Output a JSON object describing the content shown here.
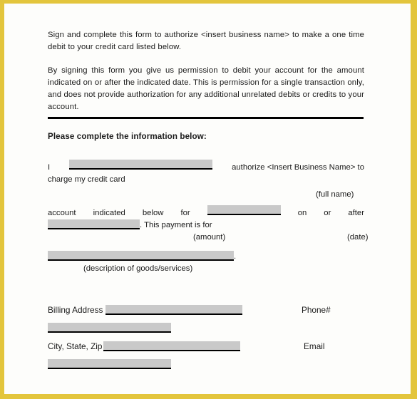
{
  "document": {
    "paragraphs": [
      "Sign and complete this form to authorize <insert business name> to make a one time debit to your credit card listed below.",
      "By signing this form you give us permission to debit your account for the amount indicated on or after the indicated date.  This is permission for a single transaction only, and does not provide authorization for any additional unrelated debits or credits to your account."
    ],
    "section_heading": "Please complete the information below:",
    "authorize_line": {
      "prefix": "I",
      "suffix": "authorize <Insert Business Name> to",
      "continuation": "charge my credit card",
      "caption": "(full      name)"
    },
    "account_line": {
      "word_1": "account",
      "word_2": "indicated",
      "word_3": "below",
      "word_4": "for",
      "word_5": "on",
      "word_6": "or",
      "word_7": "after",
      "continuation": ". This payment is for",
      "caption_amount": "(amount)",
      "caption_date": "(date)"
    },
    "description_line": {
      "trailing_period": ".",
      "caption": "(description of goods/services)"
    },
    "contact": {
      "billing_address_label": "Billing Address",
      "phone_label": "Phone#",
      "city_state_zip_label": "City, State, Zip",
      "email_label": "Email"
    }
  },
  "colors": {
    "frame": "#e3c53c",
    "page": "#fdfdfb",
    "blank_fill": "#c9c9c9",
    "rule": "#000000",
    "text": "#1a1a1a"
  }
}
